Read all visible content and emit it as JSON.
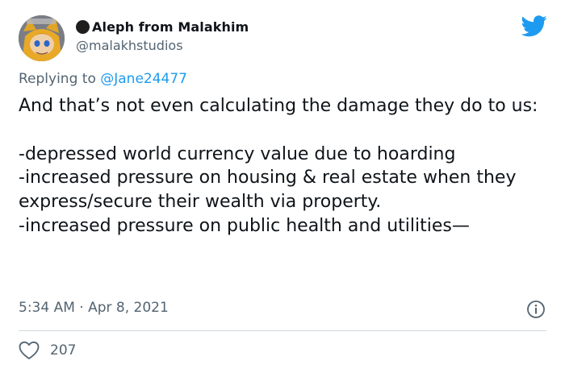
{
  "tweet": {
    "author": {
      "display_name": "Aleph from Malakhim",
      "handle": "@malakhstudios",
      "avatar_icon": "avatar-image"
    },
    "reply": {
      "prefix": "Replying to ",
      "mention": "@Jane24477"
    },
    "text": "And that’s not even calculating the damage they do to us:\n\n-depressed world currency value due to hoarding\n-increased pressure on housing & real estate when they\nexpress/secure their wealth via property.\n-increased pressure on public health and utilities—",
    "timestamp": "5:34 AM · Apr 8, 2021",
    "likes": "207"
  },
  "colors": {
    "brand": "#1d9bf0",
    "text": "#0f1419",
    "muted": "#536471",
    "divider": "#cfd9de"
  },
  "icons": {
    "logo": "twitter-bird-icon",
    "info": "info-icon",
    "like": "heart-icon"
  }
}
